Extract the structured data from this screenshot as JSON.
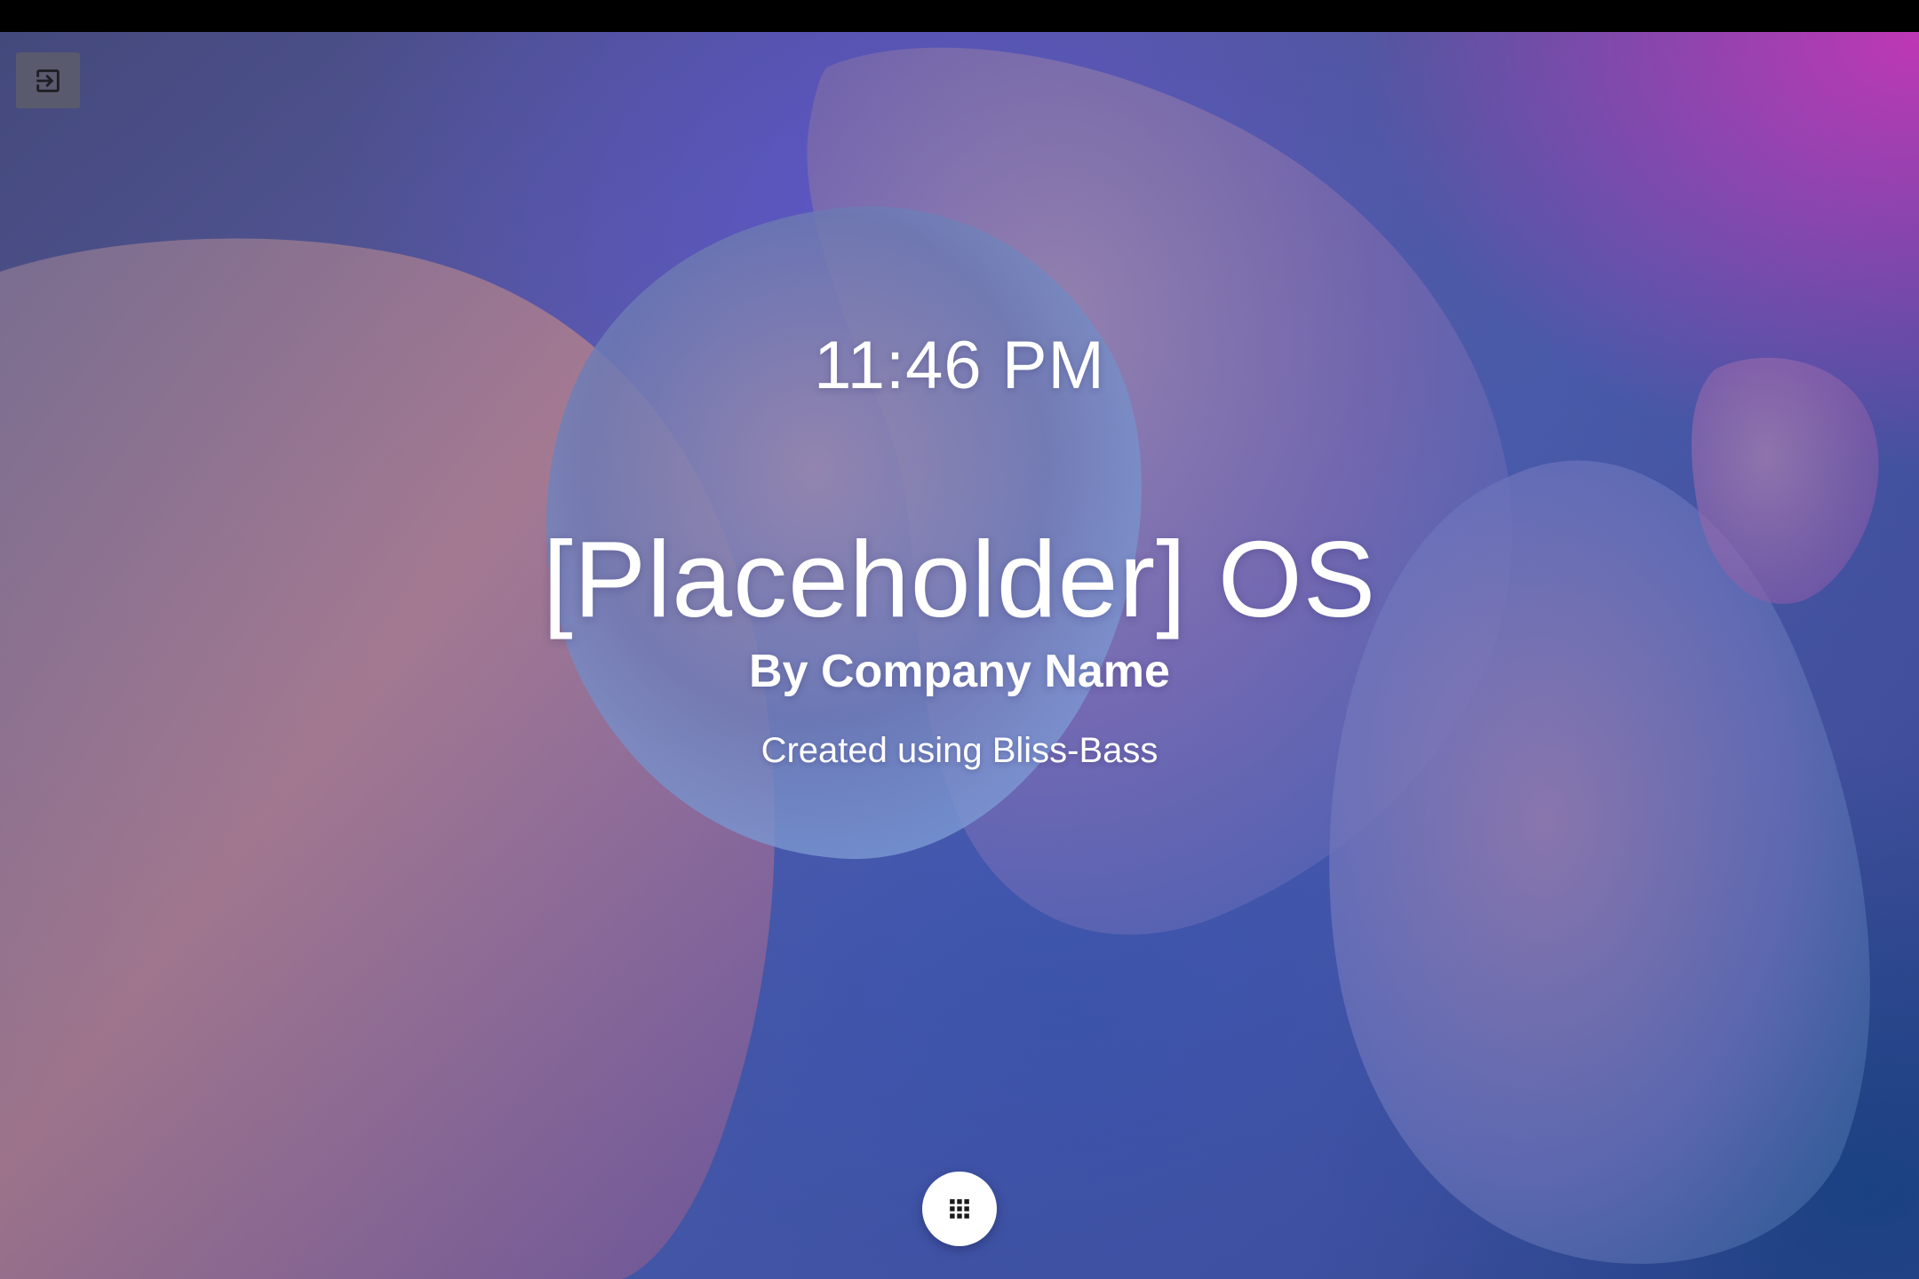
{
  "home": {
    "clock": "11:46 PM",
    "os_title": "[Placeholder] OS",
    "company": "By Company Name",
    "created_with": "Created using Bliss-Bass"
  },
  "icons": {
    "exit": "exit-to-app-icon",
    "app_drawer": "apps-grid-icon"
  },
  "colors": {
    "status_bar": "#000000",
    "text": "#ffffff",
    "exit_button_bg": "#5f5f69",
    "app_drawer_bg": "#ffffff",
    "app_drawer_icon": "#1a1a1a"
  }
}
